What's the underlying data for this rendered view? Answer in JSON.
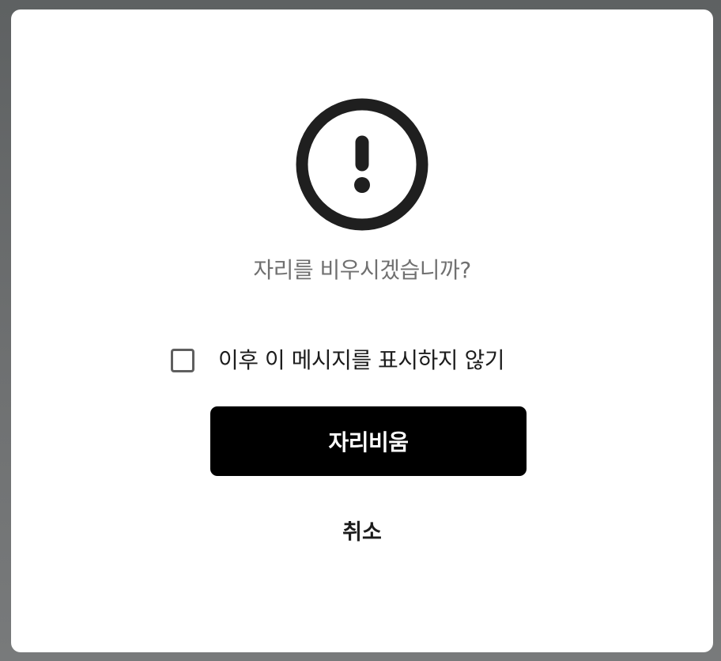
{
  "dialog": {
    "icon": "exclamation-circle-icon",
    "message": "자리를 비우시겠습니까?",
    "dont_show_label": "이후 이 메시지를 표시하지 않기",
    "dont_show_checked": false,
    "primary_label": "자리비움",
    "cancel_label": "취소"
  },
  "colors": {
    "primary_button": "#000000",
    "primary_text": "#ffffff",
    "message_text": "#707070",
    "icon_stroke": "#1f1f1f"
  }
}
